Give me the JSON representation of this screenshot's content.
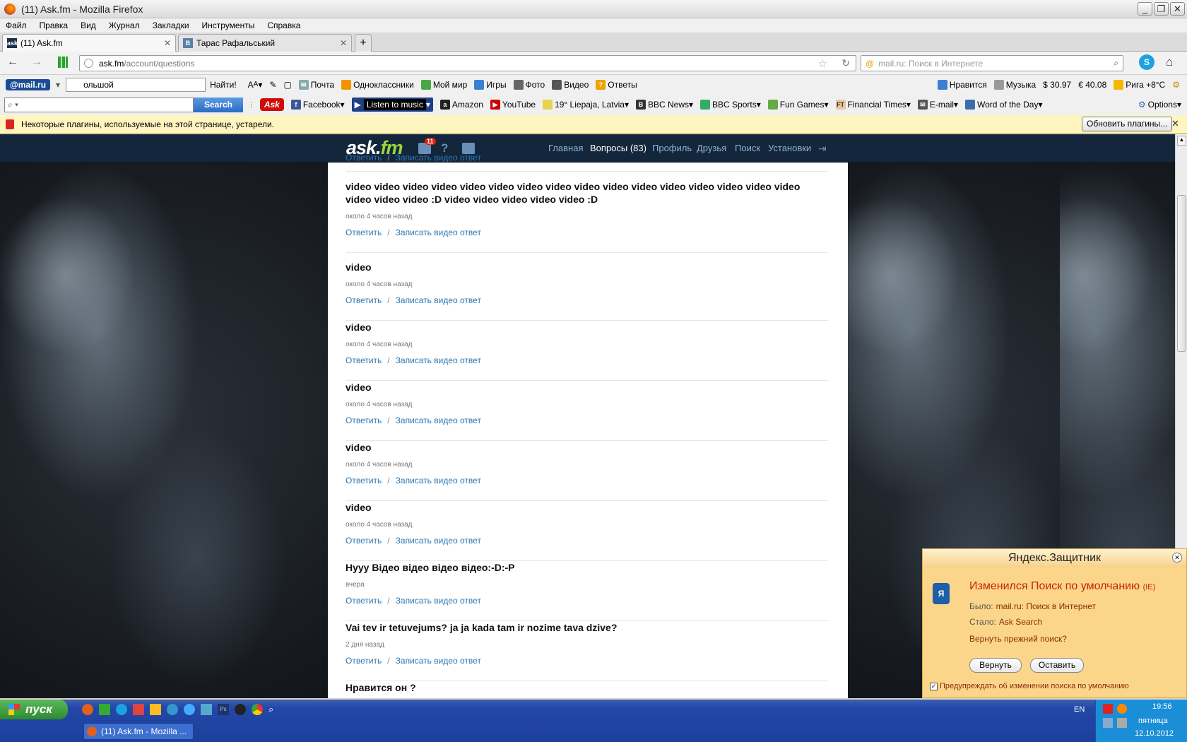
{
  "window": {
    "title": "(11) Ask.fm - Mozilla Firefox"
  },
  "menu": [
    "Файл",
    "Правка",
    "Вид",
    "Журнал",
    "Закладки",
    "Инструменты",
    "Справка"
  ],
  "tabs": [
    {
      "label": "(11) Ask.fm",
      "active": true
    },
    {
      "label": "Тарас Рафальський",
      "active": false
    }
  ],
  "nav": {
    "url_host": "ask.fm",
    "url_path": "/account/questions",
    "search_placeholder": "mail.ru: Поиск в Интернете"
  },
  "mail_toolbar": {
    "logo": "@mail.ru",
    "search_value": "ольшой",
    "find_label": "Найти!",
    "items": [
      "Почта",
      "Одноклассники",
      "Мой мир",
      "Игры",
      "Фото",
      "Видео",
      "Ответы"
    ],
    "right": [
      "Нравится",
      "Музыка",
      "$ 30.97",
      "€ 40.08",
      "Рига +8°C"
    ]
  },
  "ask_toolbar": {
    "search_button": "Search",
    "items": [
      "Facebook",
      "Listen to music",
      "Amazon",
      "YouTube",
      "19° Liepaja, Latvia",
      "BBC News",
      "BBC Sports",
      "Fun Games",
      "Financial Times",
      "E-mail",
      "Word of the Day"
    ],
    "options": "Options"
  },
  "plugin_bar": {
    "message": "Некоторые плагины, используемые на этой странице, устарели.",
    "button": "Обновить плагины..."
  },
  "askfm": {
    "logo_main": "ask.",
    "logo_accent": "fm",
    "badge": "11",
    "nav": [
      "Главная",
      "Вопросы (83)",
      "Профиль",
      "Друзья",
      "Поиск",
      "Установки"
    ],
    "answer_label": "Ответить",
    "video_label": "Записать видео ответ",
    "questions": [
      {
        "text": "video video video video video video video video video video video video video video video video video video video :D video video video video video :D",
        "time": "около 4 часов назад"
      },
      {
        "text": "video",
        "time": "около 4 часов назад"
      },
      {
        "text": "video",
        "time": "около 4 часов назад"
      },
      {
        "text": "video",
        "time": "около 4 часов назад"
      },
      {
        "text": "video",
        "time": "около 4 часов назад"
      },
      {
        "text": "video",
        "time": "около 4 часов назад"
      },
      {
        "text": "Нууу Вiдео вiдео вiдео вiдео:-D:-P",
        "time": "вчера"
      },
      {
        "text": "Vai tev ir tetuvejums? ja ja kada tam ir nozime tava dzive?",
        "time": "2 дня назад"
      },
      {
        "text": "Нравится он ?",
        "time": ""
      }
    ]
  },
  "yandex": {
    "title": "Яндекс.Защитник",
    "headline": "Изменился Поиск по умолчанию",
    "headline_tag": "(IE)",
    "was_label": "Было:",
    "was_value": "mail.ru: Поиск в Интернет",
    "now_label": "Стало:",
    "now_value": "Ask Search",
    "question": "Вернуть прежний поиск?",
    "btn_return": "Вернуть",
    "btn_keep": "Оставить",
    "checkbox": "Предупреждать об изменении поиска по умолчанию"
  },
  "taskbar": {
    "start": "пуск",
    "task": "(11) Ask.fm - Mozilla ...",
    "lang": "EN",
    "time": "19:56",
    "day": "пятница",
    "date": "12.10.2012"
  }
}
